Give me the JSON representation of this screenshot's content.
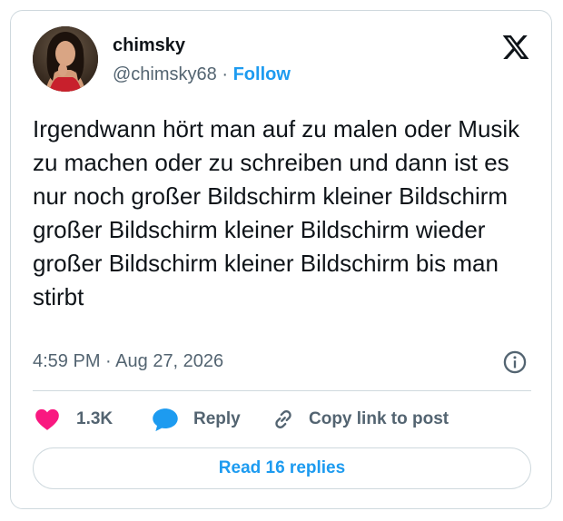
{
  "author": {
    "display_name": "chimsky",
    "handle": "@chimsky68",
    "separator": "·",
    "follow_label": "Follow"
  },
  "tweet": {
    "text": "Irgendwann hört man auf zu malen oder Musik zu machen oder zu schreiben und dann ist es nur noch großer Bildschirm kleiner Bildschirm großer Bildschirm kleiner Bildschirm wieder großer Bildschirm kleiner Bildschirm bis man stirbt",
    "time": "4:59 PM",
    "date_separator": "·",
    "date": "Aug 27, 2026"
  },
  "actions": {
    "like_count": "1.3K",
    "reply_label": "Reply",
    "copy_link_label": "Copy link to post"
  },
  "read_replies_label": "Read 16 replies",
  "icons": {
    "logo": "x-logo-icon",
    "info": "info-icon",
    "like": "heart-icon",
    "reply": "speech-bubble-icon",
    "copy": "link-icon"
  },
  "colors": {
    "accent": "#1d9bf0",
    "like": "#f91880",
    "text": "#0f1419",
    "secondary": "#536471",
    "border": "#cfd9de"
  }
}
